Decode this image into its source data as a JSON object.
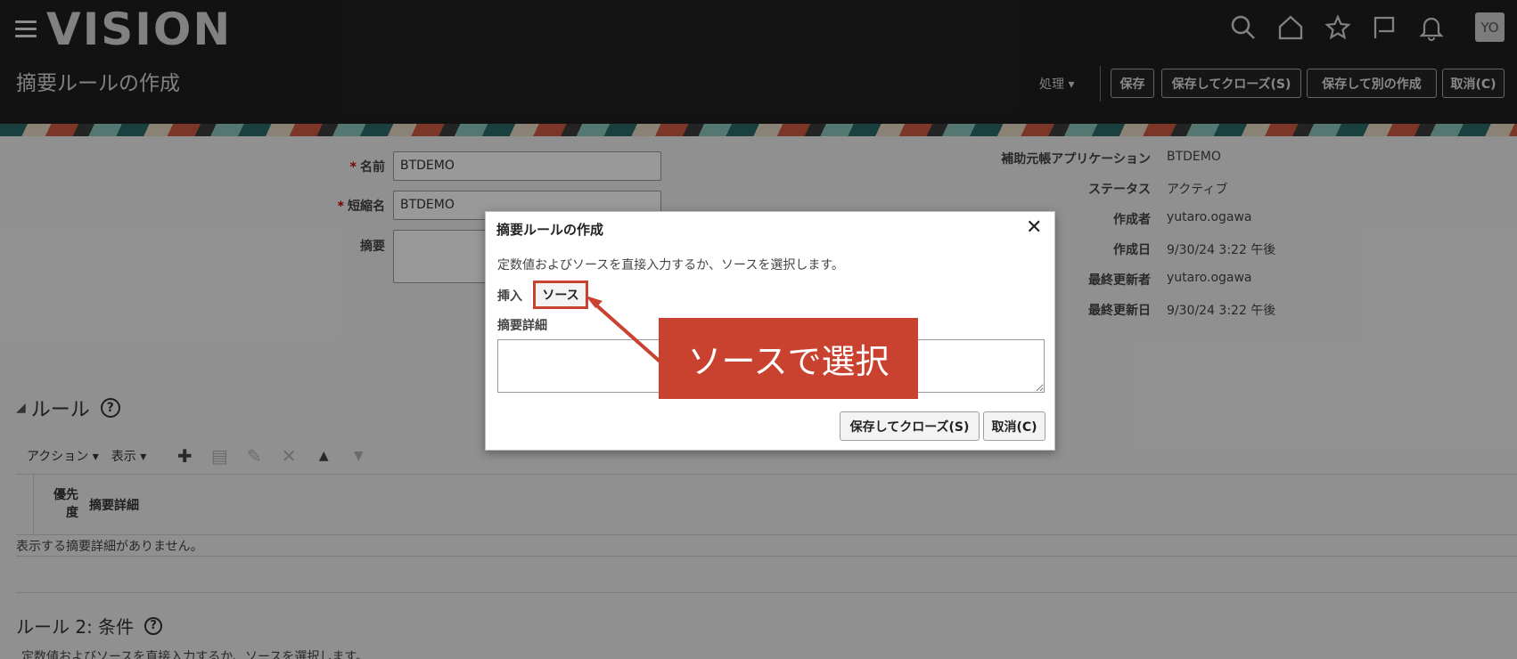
{
  "header": {
    "logo": "VISION",
    "page_title": "摘要ルールの作成",
    "avatar": "YO",
    "actions_menu": "処理 ▾",
    "buttons": {
      "save": "保存",
      "save_close": "保存してクローズ(S)",
      "save_new": "保存して別の作成",
      "cancel": "取消(C)"
    }
  },
  "form": {
    "name_label": "名前",
    "name_value": "BTDEMO",
    "short_name_label": "短縮名",
    "short_name_value": "BTDEMO",
    "summary_label": "摘要",
    "required_mark": "*",
    "info": [
      {
        "label": "補助元帳アプリケーション",
        "value": "BTDEMO"
      },
      {
        "label": "ステータス",
        "value": "アクティブ"
      },
      {
        "label": "作成者",
        "value": "yutaro.ogawa"
      },
      {
        "label": "作成日",
        "value": "9/30/24 3:22 午後"
      },
      {
        "label": "最終更新者",
        "value": "yutaro.ogawa"
      },
      {
        "label": "最終更新日",
        "value": "9/30/24 3:22 午後"
      }
    ]
  },
  "rules": {
    "title": "ルール",
    "help": "?",
    "toolbar": {
      "actions": "アクション ▾",
      "view": "表示 ▾"
    },
    "columns": {
      "priority_line1": "優先",
      "priority_line2": "度",
      "detail": "摘要詳細"
    },
    "empty_message": "表示する摘要詳細がありません。",
    "rule2_title": "ルール 2: 条件",
    "rule2_text": "定数値およびソースを直接入力するか、ソースを選択します。"
  },
  "dialog": {
    "title": "摘要ルールの作成",
    "close": "✕",
    "instruction": "定数値およびソースを直接入力するか、ソースを選択します。",
    "insert_label": "挿入",
    "source_button": "ソース",
    "detail_label": "摘要詳細",
    "save_close": "保存してクローズ(S)",
    "cancel": "取消(C)"
  },
  "callout": {
    "text": "ソースで選択",
    "color": "#c9412f"
  }
}
